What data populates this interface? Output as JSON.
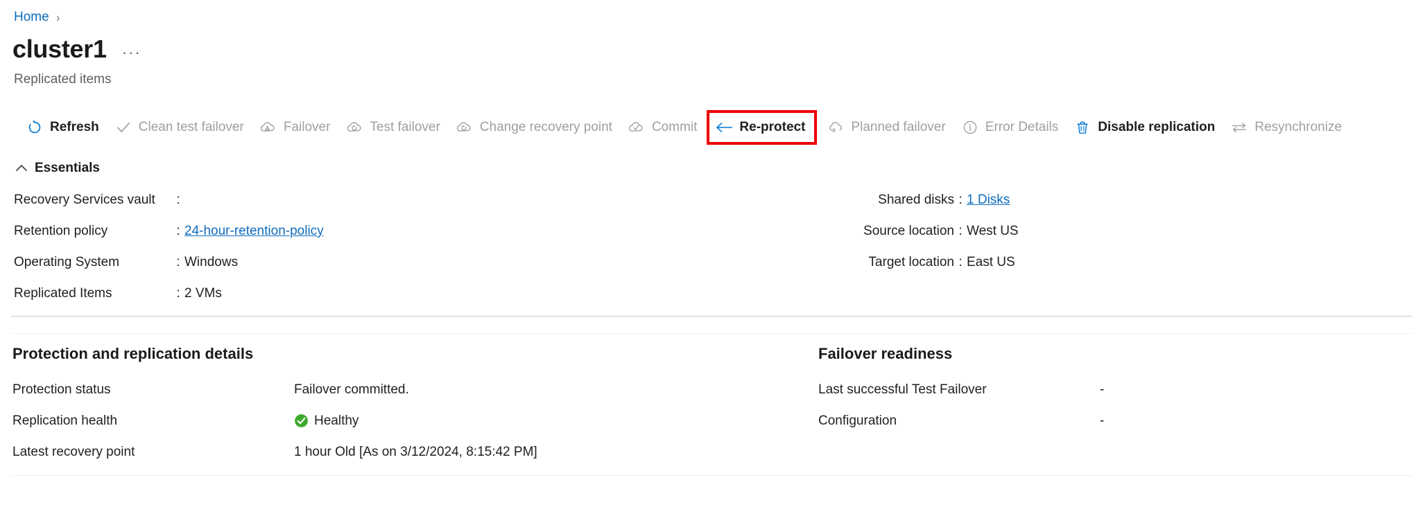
{
  "breadcrumb": {
    "home_label": "Home",
    "separator": "›"
  },
  "header": {
    "title": "cluster1",
    "ellipsis": "···",
    "subtitle": "Replicated items"
  },
  "colors": {
    "link": "#0f6cbd",
    "highlight_border": "#ee0000",
    "healthy_green": "#3FA92C",
    "disabled_text": "#a19f9d",
    "enabled_text": "#201f1e"
  },
  "command_bar": {
    "items": [
      {
        "label": "Refresh",
        "icon": "refresh-icon",
        "state": "enabled",
        "highlighted": false
      },
      {
        "label": "Clean test failover",
        "icon": "checkmark-icon",
        "state": "disabled",
        "highlighted": false
      },
      {
        "label": "Failover",
        "icon": "cloud-failover-icon",
        "state": "disabled",
        "highlighted": false
      },
      {
        "label": "Test failover",
        "icon": "cloud-test-failover-icon",
        "state": "disabled",
        "highlighted": false
      },
      {
        "label": "Change recovery point",
        "icon": "cloud-recovery-icon",
        "state": "disabled",
        "highlighted": false
      },
      {
        "label": "Commit",
        "icon": "cloud-check-icon",
        "state": "disabled",
        "highlighted": false
      },
      {
        "label": "Re-protect",
        "icon": "left-arrow-icon",
        "state": "enabled",
        "highlighted": true
      },
      {
        "label": "Planned failover",
        "icon": "cloud-planned-icon",
        "state": "disabled",
        "highlighted": false
      },
      {
        "label": "Error Details",
        "icon": "info-circle-icon",
        "state": "disabled",
        "highlighted": false
      },
      {
        "label": "Disable replication",
        "icon": "trash-icon",
        "state": "enabled",
        "highlighted": false
      },
      {
        "label": "Resynchronize",
        "icon": "resync-arrows-icon",
        "state": "disabled",
        "highlighted": false
      }
    ]
  },
  "essentials": {
    "title": "Essentials",
    "collapse_icon": "chevron-up-icon",
    "left": [
      {
        "key": "Recovery Services vault",
        "colon": ":",
        "value": "",
        "is_link": false
      },
      {
        "key": "Retention policy",
        "colon": ":",
        "value": "24-hour-retention-policy",
        "is_link": true
      },
      {
        "key": "Operating System",
        "colon": ":",
        "value": "Windows",
        "is_link": false
      },
      {
        "key": "Replicated Items",
        "colon": ":",
        "value": "2 VMs",
        "is_link": false
      }
    ],
    "right": [
      {
        "key": "Shared disks",
        "colon": ":",
        "value": "1 Disks",
        "is_link": true
      },
      {
        "key": "Source location",
        "colon": ":",
        "value": "West US",
        "is_link": false
      },
      {
        "key": "Target location",
        "colon": ":",
        "value": "East US",
        "is_link": false
      }
    ]
  },
  "protection_section": {
    "title": "Protection and replication details",
    "rows": [
      {
        "key": "Protection status",
        "value": "Failover committed.",
        "badge": null
      },
      {
        "key": "Replication health",
        "value": "Healthy",
        "badge": "healthy-check-icon"
      },
      {
        "key": "Latest recovery point",
        "value": "1 hour Old [As on 3/12/2024, 8:15:42 PM]",
        "badge": null
      }
    ]
  },
  "failover_section": {
    "title": "Failover readiness",
    "rows": [
      {
        "key": "Last successful Test Failover",
        "value": "-"
      },
      {
        "key": "Configuration",
        "value": "-"
      }
    ]
  }
}
